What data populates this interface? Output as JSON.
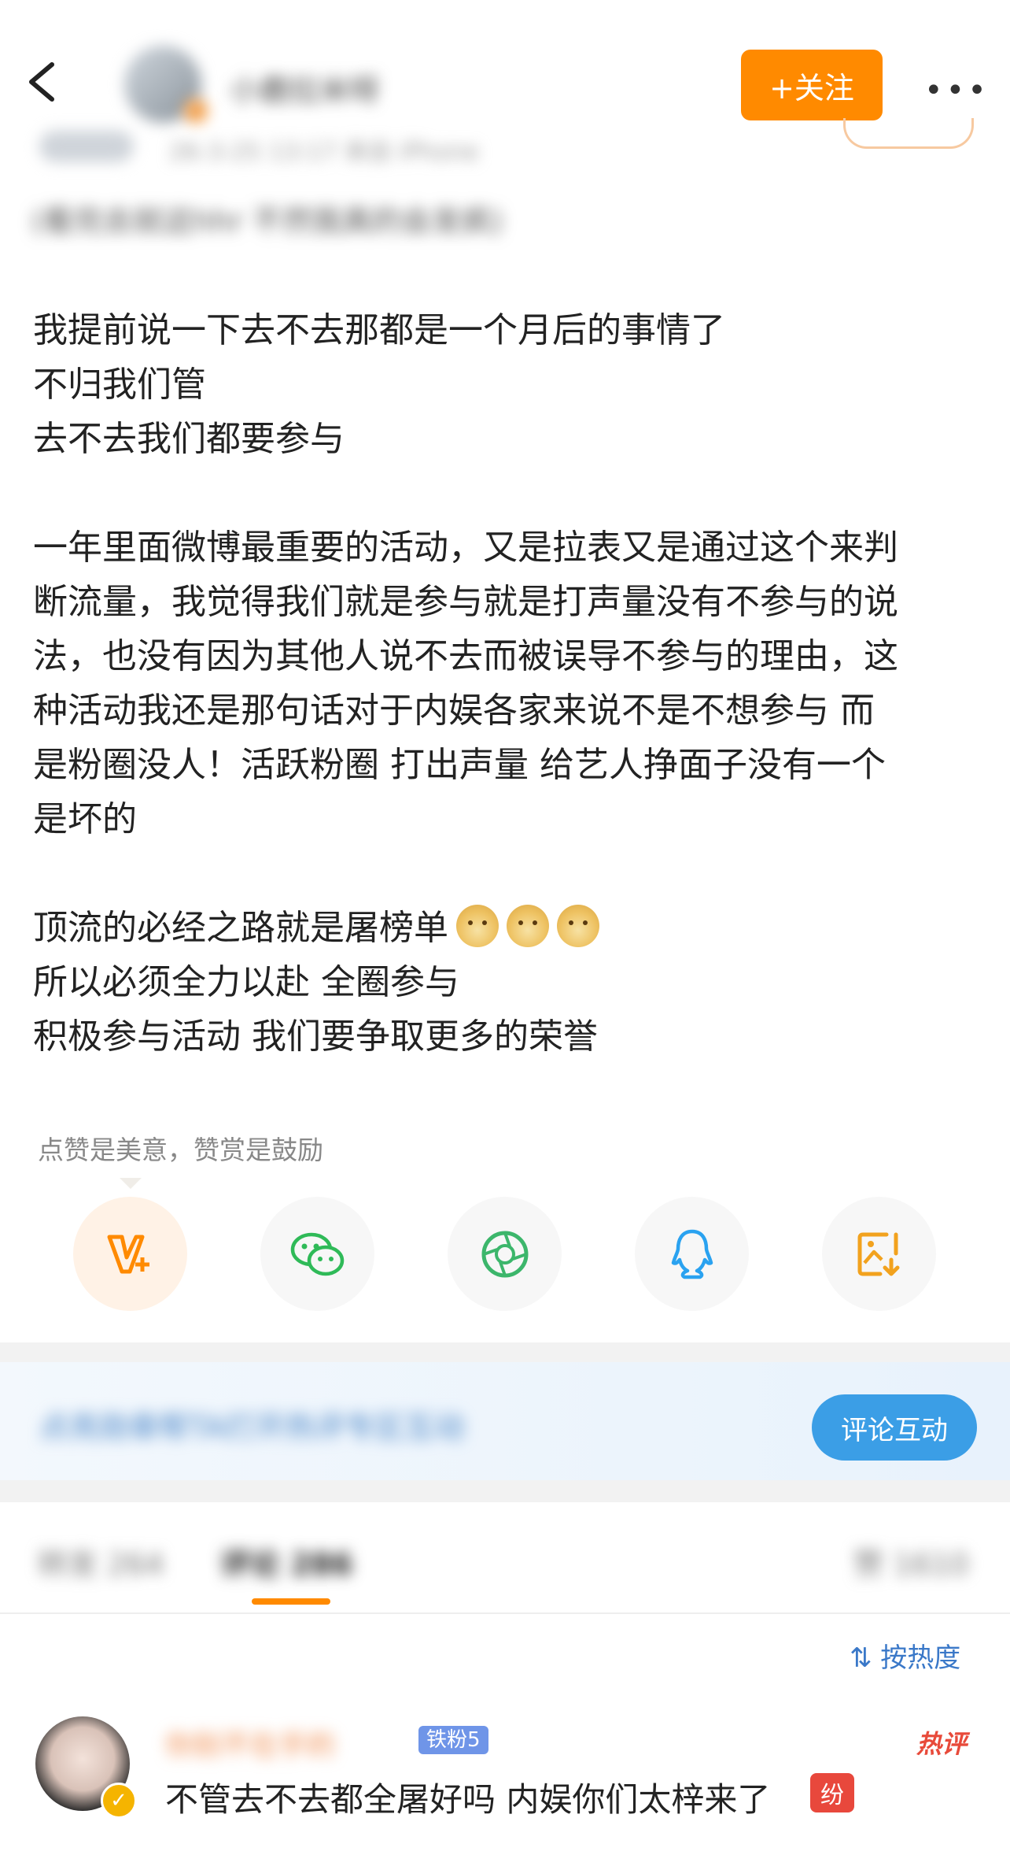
{
  "header": {
    "follow_label": "+关注",
    "more_label": "•••",
    "user_name": "小鹿拉米呀",
    "sub_meta": "26-3-25 13:17 来自 iPhone",
    "source_line": "(看完去就这hhr 不然我真的会发疯)"
  },
  "post": {
    "paragraphs": [
      [
        "我提前说一下去不去那都是一个月后的事情了",
        "不归我们管",
        "去不去我们都要参与"
      ],
      [
        "一年里面微博最重要的活动，又是拉表又是通过这个来判",
        "断流量，我觉得我们就是参与就是打声量没有不参与的说",
        "法，也没有因为其他人说不去而被误导不参与的理由，这",
        "种活动我还是那句话对于内娱各家来说不是不想参与 而",
        "是粉圈没人！活跃粉圈 打出声量 给艺人挣面子没有一个",
        "是坏的"
      ],
      [
        "顶流的必经之路就是屠榜单",
        "所以必须全力以赴  全圈参与",
        "积极参与活动 我们要争取更多的荣誉"
      ]
    ]
  },
  "reward_hint": "点赞是美意，赞赏是鼓励",
  "share_buttons": [
    {
      "name": "reward",
      "icon": "v-plus-icon",
      "color": "#ff8a00"
    },
    {
      "name": "wechat",
      "icon": "wechat-icon",
      "color": "#2fba58"
    },
    {
      "name": "moments",
      "icon": "moments-icon",
      "color": "#3cb66b"
    },
    {
      "name": "qq",
      "icon": "qq-icon",
      "color": "#2aa2f0"
    },
    {
      "name": "save-image",
      "icon": "save-image-icon",
      "color": "#f2a21e"
    }
  ],
  "banner": {
    "text": "点亮勋章帮TA打开热评专区互动",
    "button_label": "评论互动"
  },
  "tabs": {
    "repost": "转发 264",
    "comments": "评论 286",
    "likes": "赞 1610"
  },
  "sort_label": "按热度",
  "comment": {
    "name": "你别不在乎的",
    "badge": "铁粉5",
    "hot_label": "热评",
    "text": "不管去不去都全屠好吗 内娱你们太梓来了",
    "sticker": "纷"
  },
  "colors": {
    "accent": "#ff8a00",
    "link": "#3a78c8",
    "banner_button": "#3b9ee6"
  }
}
